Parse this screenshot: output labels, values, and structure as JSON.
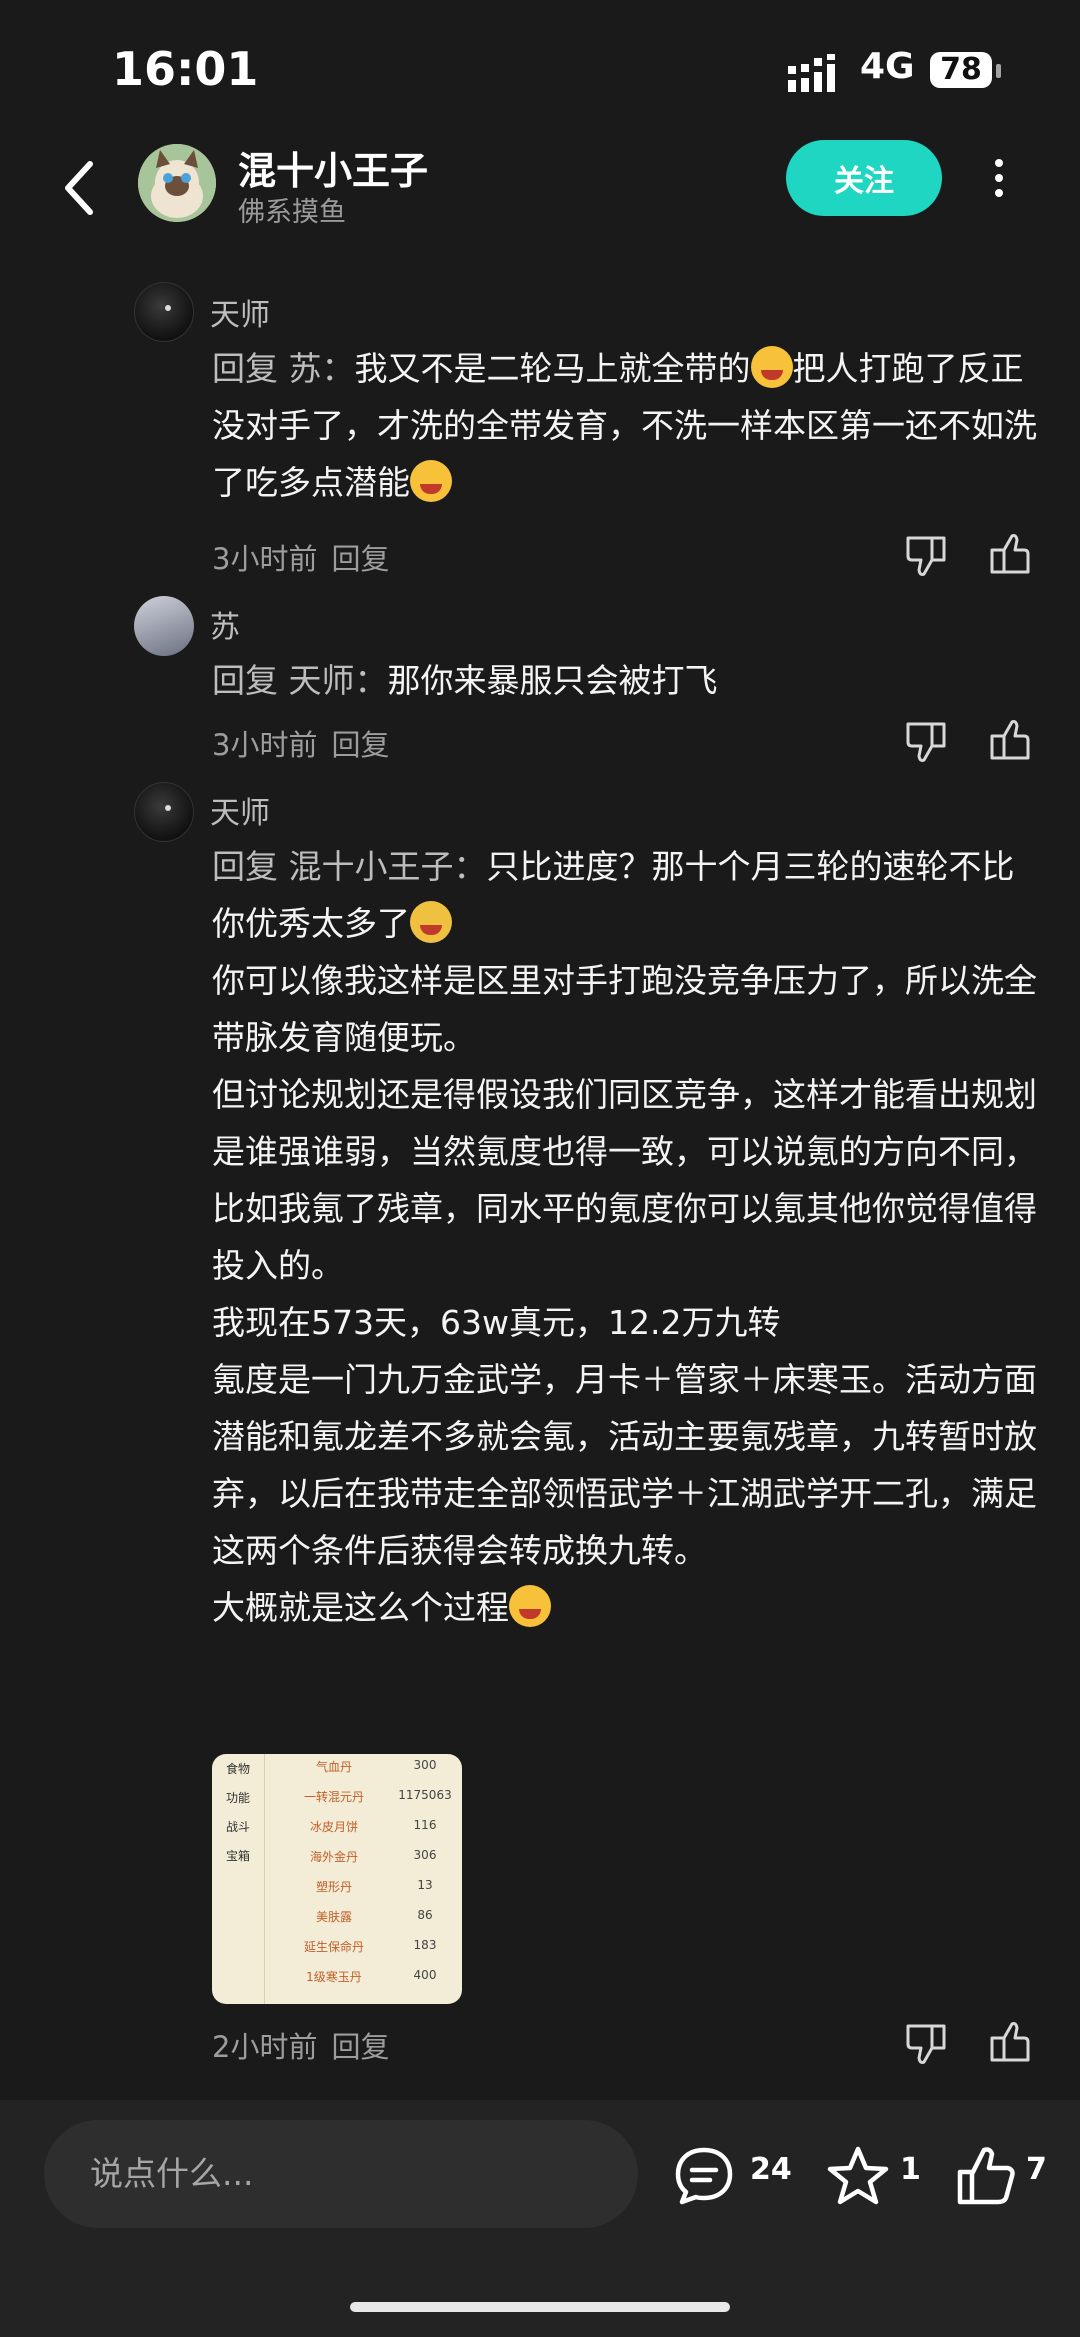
{
  "status": {
    "time": "16:01",
    "network": "4G",
    "battery": "78"
  },
  "header": {
    "name": "混十小王子",
    "subtitle": "佛系摸鱼",
    "follow_label": "关注"
  },
  "comments": [
    {
      "author": "天师",
      "reply_prefix": "回复 苏：",
      "text": "我又不是二轮马上就全带的",
      "text2": "把人打跑了反正没对手了，才洗的全带发育，不洗一样本区第一还不如洗了吃多点潜能",
      "time": "3小时前",
      "reply_label": "回复"
    },
    {
      "author": "苏",
      "reply_prefix": "回复 天师：",
      "text": "那你来暴服只会被打飞",
      "time": "3小时前",
      "reply_label": "回复"
    },
    {
      "author": "天师",
      "reply_prefix": "回复 混十小王子：",
      "line1": "只比进度？那十个月三轮的速轮不比你优秀太多了",
      "line2": "你可以像我这样是区里对手打跑没竞争压力了，所以洗全带脉发育随便玩。",
      "line3": "但讨论规划还是得假设我们同区竞争，这样才能看出规划是谁强谁弱，当然氪度也得一致，可以说氪的方向不同，比如我氪了残章，同水平的氪度你可以氪其他你觉得值得投入的。",
      "line4": "我现在573天，63w真元，12.2万九转",
      "line5": "氪度是一门九万金武学，月卡＋管家＋床寒玉。活动方面潜能和氪龙差不多就会氪，活动主要氪残章，九转暂时放弃，以后在我带走全部领悟武学＋江湖武学开二孔，满足这两个条件后获得会转成换九转。",
      "line6": "大概就是这么个过程",
      "time": "2小时前",
      "reply_label": "回复"
    }
  ],
  "thumbnail": {
    "tabs": [
      "食物",
      "功能",
      "战斗",
      "宝箱"
    ],
    "rows": [
      {
        "name": "气血丹",
        "value": "300"
      },
      {
        "name": "一转混元丹",
        "value": "1175063"
      },
      {
        "name": "冰皮月饼",
        "value": "116"
      },
      {
        "name": "海外金丹",
        "value": "306"
      },
      {
        "name": "塑形丹",
        "value": "13"
      },
      {
        "name": "美肤露",
        "value": "86"
      },
      {
        "name": "延生保命丹",
        "value": "183"
      },
      {
        "name": "1级寒玉丹",
        "value": "400"
      }
    ]
  },
  "bottom": {
    "input_placeholder": "说点什么...",
    "comments_count": "24",
    "favorites_count": "1",
    "likes_count": "7"
  },
  "colors": {
    "accent": "#1ed6c1",
    "background": "#1a1a1a"
  }
}
